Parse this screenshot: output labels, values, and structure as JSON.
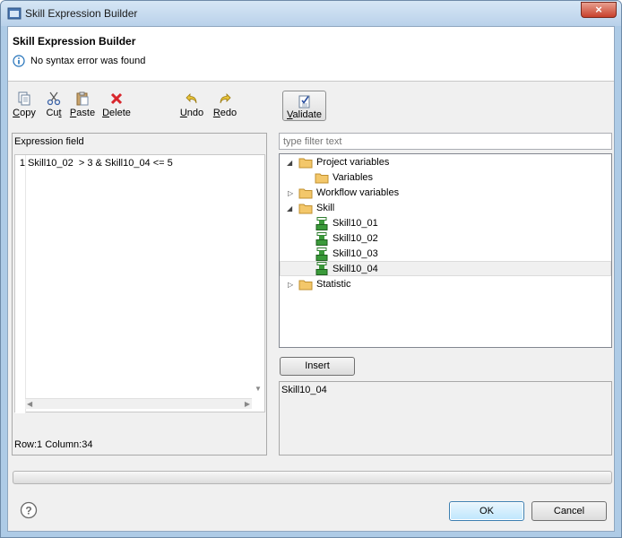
{
  "window": {
    "title": "Skill Expression Builder",
    "close_glyph": "×"
  },
  "header": {
    "title": "Skill Expression Builder",
    "message": "No syntax error was found"
  },
  "toolbar": {
    "copy": {
      "mnemonic": "C",
      "rest": "opy"
    },
    "cut": {
      "pre": "Cu",
      "mnemonic": "t"
    },
    "paste": {
      "mnemonic": "P",
      "rest": "aste"
    },
    "delete": {
      "mnemonic": "D",
      "rest": "elete"
    },
    "undo": {
      "mnemonic": "U",
      "rest": "ndo"
    },
    "redo": {
      "mnemonic": "R",
      "rest": "edo"
    },
    "validate": {
      "mnemonic": "V",
      "rest": "alidate"
    }
  },
  "expression": {
    "label": "Expression field",
    "line_number": "1",
    "code": "Skill10_02  > 3 & Skill10_04 <= 5",
    "status": "Row:1 Column:34"
  },
  "filter": {
    "placeholder": "type filter text"
  },
  "tree": {
    "project_variables": "Project variables",
    "variables": "Variables",
    "workflow_variables": "Workflow variables",
    "skill": "Skill",
    "skill_items": [
      "Skill10_01",
      "Skill10_02",
      "Skill10_03",
      "Skill10_04"
    ],
    "statistic": "Statistic"
  },
  "insert_label": "Insert",
  "preview_text": "Skill10_04",
  "buttons": {
    "ok": "OK",
    "cancel": "Cancel"
  },
  "colors": {
    "folder": "#f3c76a",
    "skill_icon": "#3a9a3a",
    "delete_icon": "#d8262c",
    "info_icon": "#1f6fb8"
  }
}
